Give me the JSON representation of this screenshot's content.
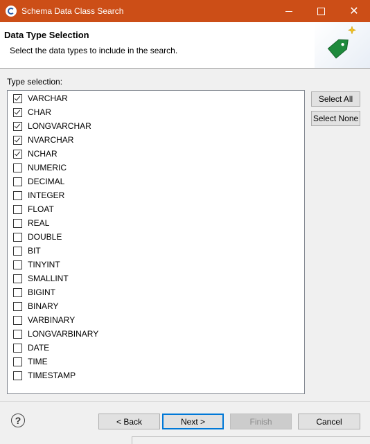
{
  "window": {
    "title": "Schema Data Class Search"
  },
  "header": {
    "title": "Data Type Selection",
    "description": "Select the data types to include in the search."
  },
  "type_selection": {
    "label": "Type selection:",
    "items": [
      {
        "label": "VARCHAR",
        "checked": true
      },
      {
        "label": "CHAR",
        "checked": true
      },
      {
        "label": "LONGVARCHAR",
        "checked": true
      },
      {
        "label": "NVARCHAR",
        "checked": true
      },
      {
        "label": "NCHAR",
        "checked": true
      },
      {
        "label": "NUMERIC",
        "checked": false
      },
      {
        "label": "DECIMAL",
        "checked": false
      },
      {
        "label": "INTEGER",
        "checked": false
      },
      {
        "label": "FLOAT",
        "checked": false
      },
      {
        "label": "REAL",
        "checked": false
      },
      {
        "label": "DOUBLE",
        "checked": false
      },
      {
        "label": "BIT",
        "checked": false
      },
      {
        "label": "TINYINT",
        "checked": false
      },
      {
        "label": "SMALLINT",
        "checked": false
      },
      {
        "label": "BIGINT",
        "checked": false
      },
      {
        "label": "BINARY",
        "checked": false
      },
      {
        "label": "VARBINARY",
        "checked": false
      },
      {
        "label": "LONGVARBINARY",
        "checked": false
      },
      {
        "label": "DATE",
        "checked": false
      },
      {
        "label": "TIME",
        "checked": false
      },
      {
        "label": "TIMESTAMP",
        "checked": false
      }
    ]
  },
  "side_buttons": {
    "select_all": "Select All",
    "select_none": "Select None"
  },
  "footer": {
    "help_glyph": "?",
    "back": "< Back",
    "next": "Next >",
    "finish": "Finish",
    "cancel": "Cancel"
  },
  "icons": {
    "app": "eclipse-icon",
    "banner": "green-tag-icon",
    "help": "help-icon"
  },
  "colors": {
    "titlebar": "#cc4e17",
    "tag_green": "#1e8a3c",
    "sparkle": "#f0c020",
    "default_button_border": "#0078d7"
  }
}
